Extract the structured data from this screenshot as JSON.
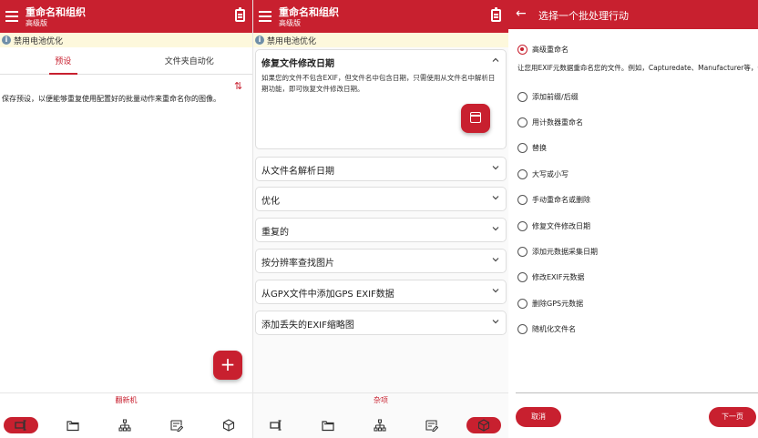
{
  "app": {
    "title": "重命名和组织",
    "subtitle": "高级版",
    "battery_banner": "禁用电池优化"
  },
  "panel1": {
    "tabs": [
      "预设",
      "文件夹自动化"
    ],
    "description": "保存预设，以便能够重复使用配置好的批量动作来重命名你的图像。",
    "fab_add": "+",
    "bottom_label": "翻新机"
  },
  "panel2": {
    "expanded_card": {
      "title": "修复文件修改日期",
      "body": "如果您的文件不包含EXIF，但文件名中包含日期，只需使用从文件名中解析日期功能，即可恢复文件修改日期。"
    },
    "cards": [
      "从文件名解析日期",
      "优化",
      "重复的",
      "按分辨率查找图片",
      "从GPX文件中添加GPS EXIF数据",
      "添加丢失的EXIF缩略图"
    ],
    "bottom_label": "杂项"
  },
  "panel3": {
    "title": "选择一个批处理行动",
    "selected_option": "高级重命名",
    "selected_description": "让您用EXIF元数据重命名您的文件。例如，Capturedate、Manufacturer等，也可使用自定义格式。",
    "options": [
      "添加前缀/后缀",
      "用计数器重命名",
      "替换",
      "大写或小写",
      "手动重命名或删除",
      "修复文件修改日期",
      "添加元数据采集日期",
      "修改EXIF元数据",
      "删除GPS元数据",
      "随机化文件名"
    ],
    "cancel_label": "取消",
    "next_label": "下一页"
  },
  "navbar": {
    "items": [
      "rename-icon",
      "folder-icon",
      "hierarchy-icon",
      "batch-edit-icon",
      "cube-icon"
    ],
    "active_panel1": 0,
    "active_panel2": 4
  },
  "colors": {
    "accent": "#c8202f",
    "banner": "#fdf8dc"
  }
}
